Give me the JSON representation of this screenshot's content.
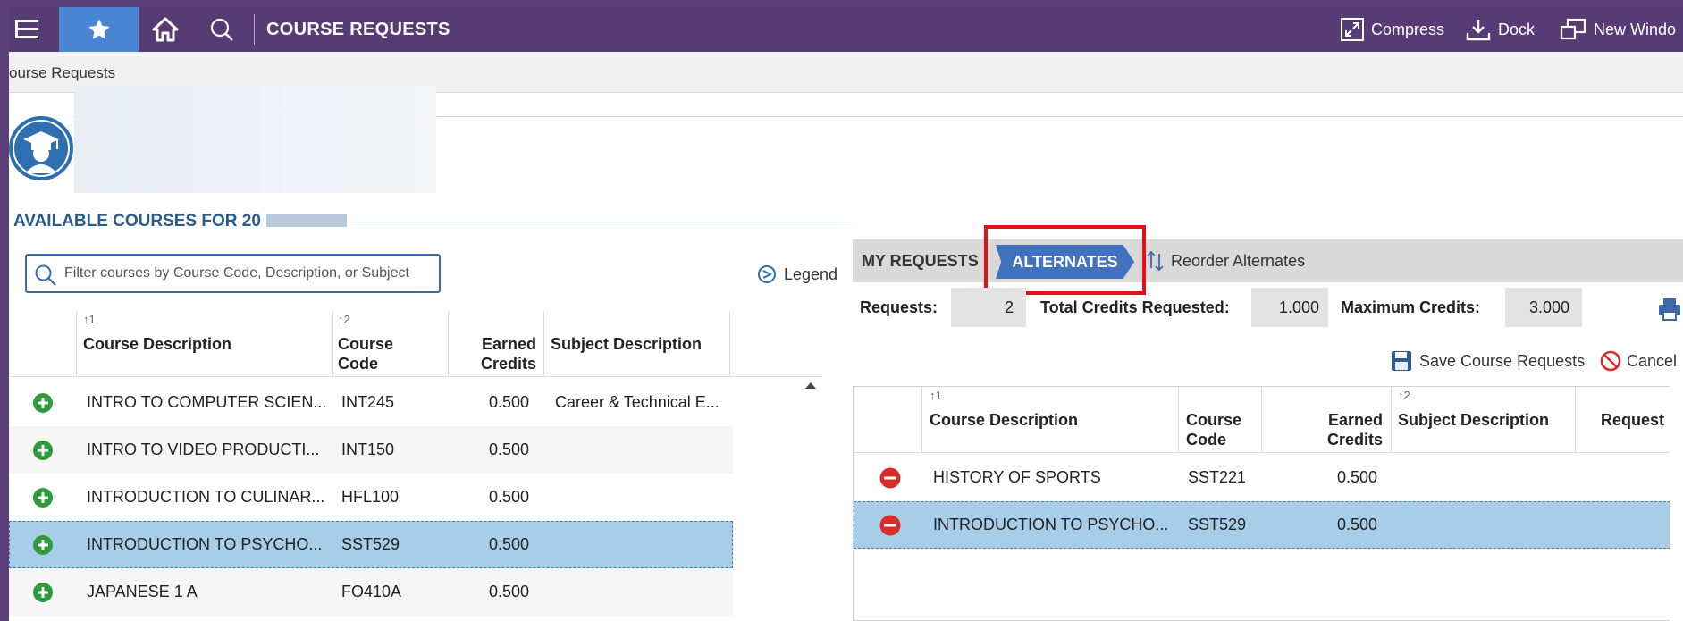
{
  "topbar": {
    "title": "COURSE REQUESTS",
    "compress_label": "Compress",
    "dock_label": "Dock",
    "new_window_label": "New Windo"
  },
  "breadcrumb": "ourse Requests",
  "available": {
    "title": "AVAILABLE COURSES FOR 20",
    "filter_placeholder": "Filter courses by Course Code, Description, or Subject",
    "legend_label": "Legend",
    "columns": {
      "course_description": "Course Description",
      "course_description_sort": "1",
      "course_code": "Course Code",
      "course_code_sort": "2",
      "earned_credits": "Earned Credits",
      "subject_description": "Subject Description"
    },
    "rows": [
      {
        "description": "INTRO TO COMPUTER SCIEN...",
        "code": "INT245",
        "credits": "0.500",
        "subject": "Career & Technical E..."
      },
      {
        "description": "INTRO TO VIDEO PRODUCTI...",
        "code": "INT150",
        "credits": "0.500",
        "subject": ""
      },
      {
        "description": "INTRODUCTION TO CULINAR...",
        "code": "HFL100",
        "credits": "0.500",
        "subject": ""
      },
      {
        "description": "INTRODUCTION TO PSYCHO...",
        "code": "SST529",
        "credits": "0.500",
        "subject": ""
      },
      {
        "description": "JAPANESE 1 A",
        "code": "FO410A",
        "credits": "0.500",
        "subject": ""
      }
    ]
  },
  "tabs": {
    "my_requests": "MY REQUESTS",
    "alternates": "ALTERNATES",
    "reorder": "Reorder Alternates"
  },
  "stats": {
    "requests_label": "Requests:",
    "requests_value": "2",
    "total_label": "Total Credits Requested:",
    "total_value": "1.000",
    "max_label": "Maximum Credits:",
    "max_value": "3.000"
  },
  "actions": {
    "save": "Save Course Requests",
    "cancel": "Cancel"
  },
  "requests_grid": {
    "columns": {
      "course_description": "Course Description",
      "course_description_sort": "1",
      "course_code": "Course Code",
      "earned_credits": "Earned Credits",
      "subject_description": "Subject Description",
      "subject_sort": "2",
      "request": "Request"
    },
    "rows": [
      {
        "description": "HISTORY OF SPORTS",
        "code": "SST221",
        "credits": "0.500"
      },
      {
        "description": "INTRODUCTION TO PSYCHO...",
        "code": "SST529",
        "credits": "0.500"
      }
    ]
  },
  "colors": {
    "topbar": "#573b75",
    "favorite_active": "#4a86d4",
    "tab_active": "#4072bf",
    "selected_row": "#a8cde9",
    "add_icon": "#2e9b3a",
    "remove_icon": "#d92b2b",
    "highlight": "#e0131a"
  }
}
